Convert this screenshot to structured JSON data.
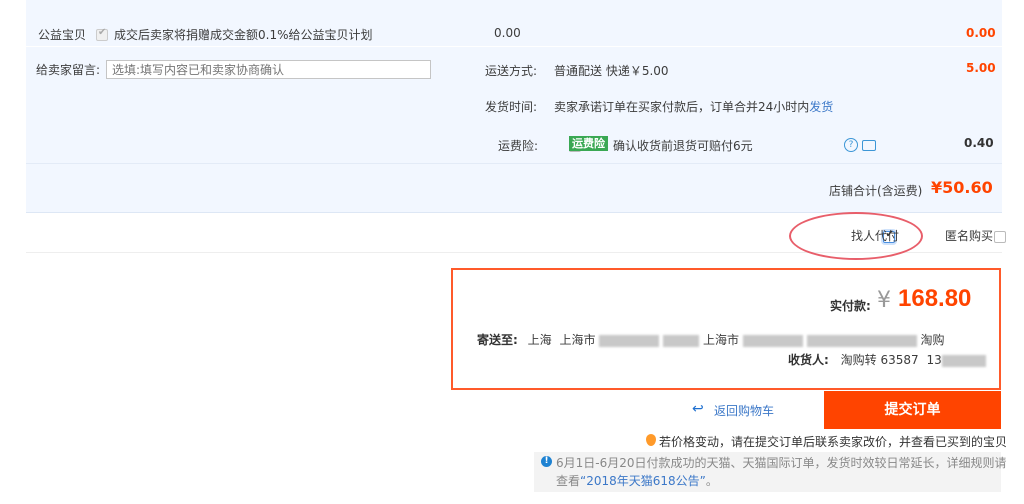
{
  "charity": {
    "label": "公益宝贝",
    "text": "成交后卖家将捐赠成交金额0.1%给公益宝贝计划",
    "amount": "0.00",
    "total": "0.00"
  },
  "message": {
    "label": "给卖家留言:",
    "placeholder": "选填:填写内容已和卖家协商确认"
  },
  "shipping": {
    "label": "运送方式:",
    "method": "普通配送 快递￥5.00",
    "total": "5.00"
  },
  "delivery": {
    "label": "发货时间:",
    "text": "卖家承诺订单在买家付款后，订单合并24小时内",
    "link": "发货"
  },
  "insurance": {
    "label": "运费险:",
    "badge": "运费险",
    "text": "确认收货前退货可赔付6元",
    "amount": "0.40"
  },
  "store_total": {
    "label": "店铺合计(含运费)",
    "amount": "¥50.60"
  },
  "options": {
    "proxy_pay": "找人代付",
    "anonymous": "匿名购买"
  },
  "summary": {
    "pay_label": "实付款:",
    "currency": "¥",
    "pay_amount": "168.80",
    "ship_to_label": "寄送至:",
    "address_parts": [
      "上海",
      "上海市",
      "上海市",
      "淘购"
    ],
    "receiver_label": "收货人:",
    "receiver": "淘购转 63587",
    "phone_prefix": "13"
  },
  "actions": {
    "back_to_cart": "返回购物车",
    "submit": "提交订单"
  },
  "notices": {
    "price_change": "若价格变动，请在提交订单后联系卖家改价，并查看已买到的宝贝",
    "promo_line1": "6月1日-6月20日付款成功的天猫、天猫国际订单，发货时效较日常延长，详细规则请",
    "promo_line2_pre": "查看",
    "promo_link": "“2018年天猫618公告”",
    "promo_line2_post": "。"
  },
  "colors": {
    "accent": "#ff4400",
    "panel_bg": "#f2f7ff",
    "link": "#3c78c8",
    "highlight_oval": "#e85e6a"
  }
}
